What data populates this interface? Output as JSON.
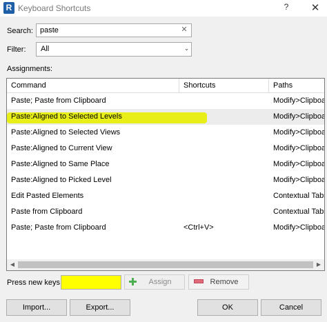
{
  "window": {
    "title": "Keyboard Shortcuts",
    "app_icon_letter": "R",
    "help_glyph": "?",
    "close_glyph": "✕"
  },
  "search": {
    "label": "Search:",
    "value": "paste",
    "clear_glyph": "✕"
  },
  "filter": {
    "label": "Filter:",
    "value": "All",
    "chevron_glyph": "⌄"
  },
  "assignments": {
    "label": "Assignments:",
    "columns": [
      "Command",
      "Shortcuts",
      "Paths"
    ],
    "rows": [
      {
        "command": "Paste; Paste from Clipboard",
        "shortcut": "",
        "path": "Modify>Clipboard"
      },
      {
        "command": "Paste:Aligned to Selected Levels",
        "shortcut": "",
        "path": "Modify>Clipboard"
      },
      {
        "command": "Paste:Aligned to Selected Views",
        "shortcut": "",
        "path": "Modify>Clipboard"
      },
      {
        "command": "Paste:Aligned to Current View",
        "shortcut": "",
        "path": "Modify>Clipboard"
      },
      {
        "command": "Paste:Aligned to Same Place",
        "shortcut": "",
        "path": "Modify>Clipboard"
      },
      {
        "command": "Paste:Aligned to Picked Level",
        "shortcut": "",
        "path": "Modify>Clipboard"
      },
      {
        "command": "Edit Pasted Elements",
        "shortcut": "",
        "path": "Contextual Tabs"
      },
      {
        "command": "Paste from Clipboard",
        "shortcut": "",
        "path": "Contextual Tabs"
      },
      {
        "command": "Paste; Paste from Clipboard",
        "shortcut": "<Ctrl+V>",
        "path": "Modify>Clipboard"
      }
    ],
    "selected_row": 1,
    "scroll_left_glyph": "◀",
    "scroll_right_glyph": "▶"
  },
  "keys": {
    "label": "Press new keys:",
    "value": "",
    "assign_label": "Assign",
    "remove_label": "Remove"
  },
  "footer": {
    "import_label": "Import...",
    "export_label": "Export...",
    "ok_label": "OK",
    "cancel_label": "Cancel"
  },
  "colors": {
    "highlight": "#e8ee00",
    "assign_icon": "#4caf50",
    "remove_icon": "#e06a7a"
  }
}
